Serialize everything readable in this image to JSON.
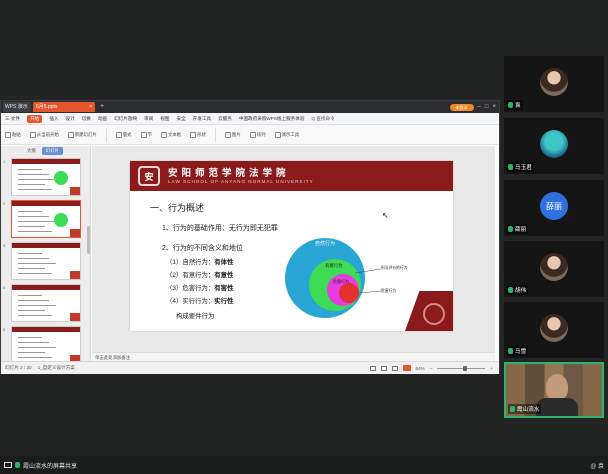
{
  "app": {
    "wps_tab": "WPS 演示",
    "doc_tab": "6月5.pptx",
    "login": "未登录"
  },
  "menu": {
    "items": [
      "三 文件",
      "开始",
      "插入",
      "设计",
      "切换",
      "动画",
      "幻灯片放映",
      "审阅",
      "视图",
      "安全",
      "开发工具",
      "云服务",
      "中国政府采购WPS线上服务体验",
      "Q 查找命令"
    ],
    "active_index": 1
  },
  "ribbon": {
    "items": [
      "粘贴",
      "从当前开始",
      "新建幻灯片",
      "版式",
      "节",
      "文本框",
      "形状",
      "图片",
      "排列",
      "演示工具"
    ]
  },
  "panel": {
    "tabs": [
      "大纲",
      "幻灯片"
    ],
    "thumb_numbers": [
      "1",
      "2",
      "3",
      "4",
      "5"
    ]
  },
  "slide": {
    "logo": "安",
    "school_cn": "安阳师范学院法学院",
    "school_en": "LAW SCHOOL OF ANYANG NORMAL UNIVERSITY",
    "title": "一、行为概述",
    "point1": "1、行为的基础作用：无行为即无犯罪",
    "point2": "2、行为的不同含义和地位",
    "sub": [
      {
        "label": "（1）自然行为：",
        "value": "有体性"
      },
      {
        "label": "（2）有意行为：",
        "value": "有意性"
      },
      {
        "label": "（3）危害行为：",
        "value": "有害性"
      },
      {
        "label": "（4）实行行为：",
        "value": "实行性"
      }
    ],
    "sub_cont": "构成要件行为",
    "diagram": {
      "outer": "自然行为",
      "mid": "有意行为",
      "inner": "危害行为",
      "ann1": "刑法评价的行为",
      "ann2": "危害行为",
      "colors": {
        "outer": "#2aa6d6",
        "mid": "#3ddc54",
        "inner": "#e83be0",
        "core": "#e53030"
      }
    }
  },
  "notes": "单击此处添加备注",
  "status": {
    "page": "幻灯片 2 / 20",
    "theme": "1_自定义设计方案",
    "zoom": "64%"
  },
  "participants": [
    {
      "name": "袁",
      "type": "photo",
      "mic": "on"
    },
    {
      "name": "马玉君",
      "type": "landscape",
      "mic": "on"
    },
    {
      "name": "薛丽",
      "type": "text",
      "initials": "薛丽",
      "mic": "on"
    },
    {
      "name": "胡伟",
      "type": "photo",
      "mic": "on"
    },
    {
      "name": "马雪",
      "type": "photo",
      "mic": "on"
    },
    {
      "name": "霞山流水",
      "type": "video",
      "mic": "on"
    }
  ],
  "bottom": {
    "share_label": "霞山流水的屏幕共享",
    "right_text": "@ 袁"
  }
}
